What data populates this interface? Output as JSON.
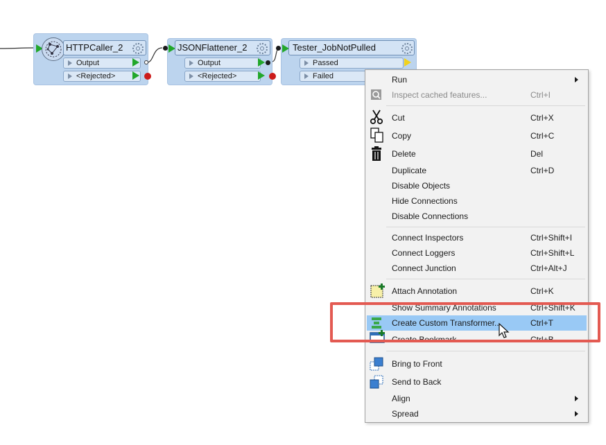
{
  "canvas": {
    "transformers": [
      {
        "title": "HTTPCaller_2",
        "ports": [
          {
            "label": "Output"
          },
          {
            "label": "<Rejected>"
          }
        ]
      },
      {
        "title": "JSONFlattener_2",
        "ports": [
          {
            "label": "Output"
          },
          {
            "label": "<Rejected>"
          }
        ]
      },
      {
        "title": "Tester_JobNotPulled",
        "ports": [
          {
            "label": "Passed"
          },
          {
            "label": "Failed"
          }
        ]
      }
    ]
  },
  "context_menu": {
    "groups": [
      [
        {
          "label": "Run",
          "shortcut": "",
          "submenu": true,
          "icon": ""
        },
        {
          "label": "Inspect cached features...",
          "shortcut": "Ctrl+I",
          "disabled": true,
          "icon": "inspect-icon"
        }
      ],
      [
        {
          "label": "Cut",
          "shortcut": "Ctrl+X",
          "icon": "scissors-icon"
        },
        {
          "label": "Copy",
          "shortcut": "Ctrl+C",
          "icon": "copy-icon"
        },
        {
          "label": "Delete",
          "shortcut": "Del",
          "icon": "trash-icon"
        },
        {
          "label": "Duplicate",
          "shortcut": "Ctrl+D",
          "icon": ""
        },
        {
          "label": "Disable Objects",
          "shortcut": "",
          "icon": ""
        },
        {
          "label": "Hide Connections",
          "shortcut": "",
          "icon": ""
        },
        {
          "label": "Disable Connections",
          "shortcut": "",
          "icon": ""
        }
      ],
      [
        {
          "label": "Connect Inspectors",
          "shortcut": "Ctrl+Shift+I",
          "icon": ""
        },
        {
          "label": "Connect Loggers",
          "shortcut": "Ctrl+Shift+L",
          "icon": ""
        },
        {
          "label": "Connect Junction",
          "shortcut": "Ctrl+Alt+J",
          "icon": ""
        }
      ],
      [
        {
          "label": "Attach Annotation",
          "shortcut": "Ctrl+K",
          "icon": "annotation-icon"
        },
        {
          "label": "Show Summary Annotations",
          "shortcut": "Ctrl+Shift+K",
          "icon": ""
        },
        {
          "label": "Create Custom Transformer...",
          "shortcut": "Ctrl+T",
          "highlighted": true,
          "icon": "custom-transformer-icon"
        },
        {
          "label": "Create Bookmark",
          "shortcut": "Ctrl+B",
          "icon": "bookmark-icon"
        }
      ],
      [
        {
          "label": "Bring to Front",
          "shortcut": "",
          "icon": "bring-to-front-icon"
        },
        {
          "label": "Send to Back",
          "shortcut": "",
          "icon": "send-to-back-icon"
        },
        {
          "label": "Align",
          "shortcut": "",
          "submenu": true,
          "icon": ""
        },
        {
          "label": "Spread",
          "shortcut": "",
          "submenu": true,
          "icon": ""
        }
      ]
    ]
  },
  "colors": {
    "node_bg": "#bcd4ee",
    "highlight": "#99c9f5",
    "callout_border": "#e35a52",
    "output_flag": "#22a72b",
    "rejected_dot": "#cc1b1b"
  }
}
